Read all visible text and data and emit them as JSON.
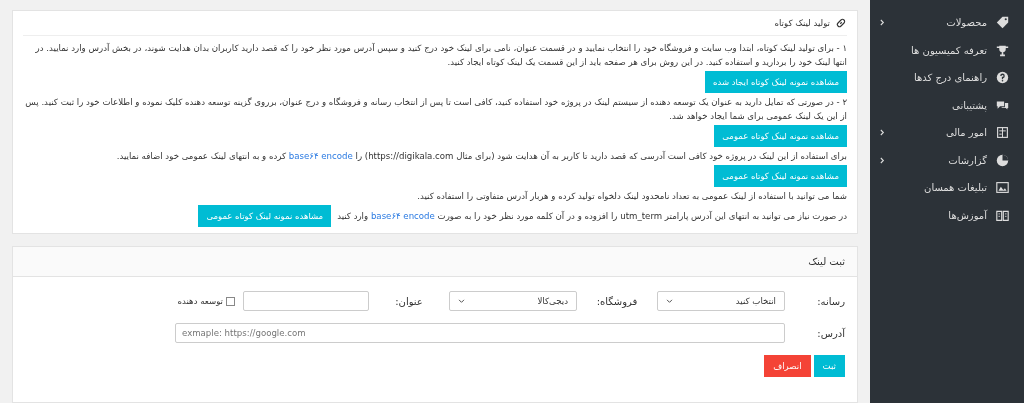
{
  "sidebar": {
    "items": [
      {
        "label": "محصولات",
        "has_submenu": true
      },
      {
        "label": "تعرفه کمیسیون ها",
        "has_submenu": false
      },
      {
        "label": "راهنمای درج کدها",
        "has_submenu": false
      },
      {
        "label": "پشتیبانی",
        "has_submenu": false
      },
      {
        "label": "امور مالی",
        "has_submenu": true
      },
      {
        "label": "گزارشات",
        "has_submenu": true
      },
      {
        "label": "تبلیغات همسان",
        "has_submenu": false
      },
      {
        "label": "آموزش‌ها",
        "has_submenu": false
      }
    ]
  },
  "guide_card": {
    "title": "تولید لینک کوتاه",
    "paragraphs": [
      [
        {
          "kind": "text",
          "text": "۱ - برای تولید لینک کوتاه، ابتدا وب سایت و فروشگاه خود را انتخاب نمایید و در قسمت عنوان، نامی برای لینک خود درج کنید و سپس آدرس مورد نظر خود را که قصد دارید کاربران بدان هدایت شوند، در بخش آدرس وارد نمایید. در انتها لینک خود را بردارید و استفاده کنید. در این روش برای هر صفحه باید از این قسمت یک لینک کوتاه ایجاد کنید."
        },
        {
          "kind": "button",
          "text": "مشاهده نمونه لینک کوتاه ایجاد شده"
        }
      ],
      [
        {
          "kind": "text",
          "text": "۲ - در صورتی که تمایل دارید به عنوان یک توسعه دهنده از سیستم لینک در پروژه خود استفاده کنید، کافی است تا پس از انتخاب رسانه و فروشگاه و درج عنوان، برروی گزینه توسعه دهنده کلیک نموده و اطلاعات خود را ثبت کنید. پس از این یک لینک عمومی برای شما ایجاد خواهد شد."
        }
      ],
      [
        {
          "kind": "button",
          "text": "مشاهده نمونه لینک کوتاه عمومی"
        }
      ],
      [
        {
          "kind": "text",
          "text": "برای استفاده از این لینک در پروژه خود کافی است آدرسی که قصد دارید تا کاربر به آن هدایت شود (برای مثال https://digikala.com) را"
        },
        {
          "kind": "link",
          "text": "base۶۴ encode"
        },
        {
          "kind": "text",
          "text": "کرده و به انتهای لینک عمومی خود اضافه نمایید."
        }
      ],
      [
        {
          "kind": "button",
          "text": "مشاهده نمونه لینک کوتاه عمومی"
        }
      ],
      [
        {
          "kind": "text",
          "text": "شما می توانید با استفاده از لینک عمومی به تعداد نامحدود لینک دلخواه تولید کرده و هربار آدرس متفاوتی را استفاده کنید."
        }
      ],
      [
        {
          "kind": "text",
          "text": "در صورت نیاز می توانید به انتهای این آدرس پارامتر utm_term را افزوده و در آن کلمه مورد نظر خود را به صورت"
        },
        {
          "kind": "link",
          "text": "base۶۴ encode"
        },
        {
          "kind": "text",
          "text": "وارد کنید"
        },
        {
          "kind": "button",
          "text": "مشاهده نمونه لینک کوتاه عمومی"
        }
      ]
    ]
  },
  "form_card": {
    "title": "ثبت لینک",
    "media": {
      "label": "رسانه:",
      "value": "انتخاب کنید"
    },
    "store": {
      "label": "فروشگاه:",
      "value": "دیجی‌کالا"
    },
    "title_field": {
      "label": "عنوان:"
    },
    "developer": {
      "label": "توسعه دهنده",
      "checked": false
    },
    "address": {
      "label": "آدرس:",
      "placeholder": "exmaple: https://google.com"
    },
    "buttons": [
      {
        "label": "ثبت",
        "kind": "primary"
      },
      {
        "label": "انصراف",
        "kind": "danger"
      }
    ]
  }
}
